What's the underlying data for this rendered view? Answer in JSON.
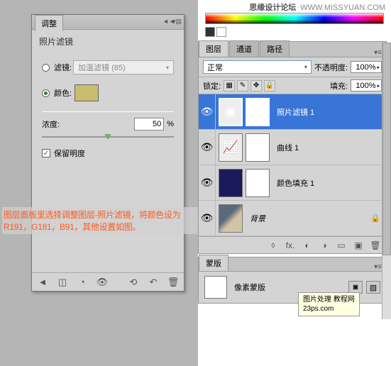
{
  "watermark": {
    "cn": "思缘设计论坛",
    "en": "WWW.MISSYUAN.COM"
  },
  "adj": {
    "tab": "调整",
    "title": "照片滤镜",
    "filter_label": "滤镜:",
    "filter_value": "加温滤镜 (85)",
    "color_label": "颜色:",
    "density_label": "浓度:",
    "density_value": "50",
    "density_unit": "%",
    "preserve_label": "保留明度"
  },
  "annotation": "图层面板里选择调整图层-照片滤镜，将颜色设为R191，G181，B91，其他设置如图。",
  "layers": {
    "tabs": [
      "图层",
      "通道",
      "路径"
    ],
    "blend": "正常",
    "opacity_label": "不透明度:",
    "opacity_value": "100%",
    "lock_label": "锁定:",
    "fill_label": "填充:",
    "fill_value": "100%",
    "items": [
      {
        "name": "照片滤镜 1",
        "selected": true,
        "type": "adj"
      },
      {
        "name": "曲线 1",
        "selected": false,
        "type": "adj"
      },
      {
        "name": "颜色填充 1",
        "selected": false,
        "type": "fill"
      },
      {
        "name": "背景",
        "selected": false,
        "type": "bg"
      }
    ]
  },
  "tooltip": {
    "line1": "图片处理 教程网",
    "line2": "23ps.com"
  },
  "mask": {
    "tab": "蒙版",
    "label": "像素蒙版"
  }
}
